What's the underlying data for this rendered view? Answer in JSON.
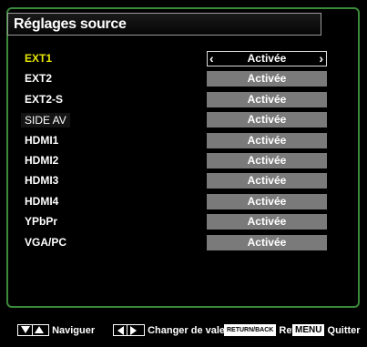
{
  "title": "Réglages source",
  "rows": [
    {
      "label": "EXT1",
      "value": "Activée"
    },
    {
      "label": "EXT2",
      "value": "Activée"
    },
    {
      "label": "EXT2-S",
      "value": "Activée"
    },
    {
      "label": "SIDE AV",
      "value": "Activée"
    },
    {
      "label": "HDMI1",
      "value": "Activée"
    },
    {
      "label": "HDMI2",
      "value": "Activée"
    },
    {
      "label": "HDMI3",
      "value": "Activée"
    },
    {
      "label": "HDMI4",
      "value": "Activée"
    },
    {
      "label": "YPbPr",
      "value": "Activée"
    },
    {
      "label": "VGA/PC",
      "value": "Activée"
    }
  ],
  "footer": {
    "navigate": "Naviguer",
    "change_value": "Changer de valeur",
    "return_key": "RETURN/BACK",
    "return_label": "Retour",
    "menu_key": "MENU",
    "quit_label": "Quitter"
  },
  "colors": {
    "selected_label": "#e6e600",
    "value_box": "#7a7a7a",
    "panel_border": "#3a8a3a"
  }
}
